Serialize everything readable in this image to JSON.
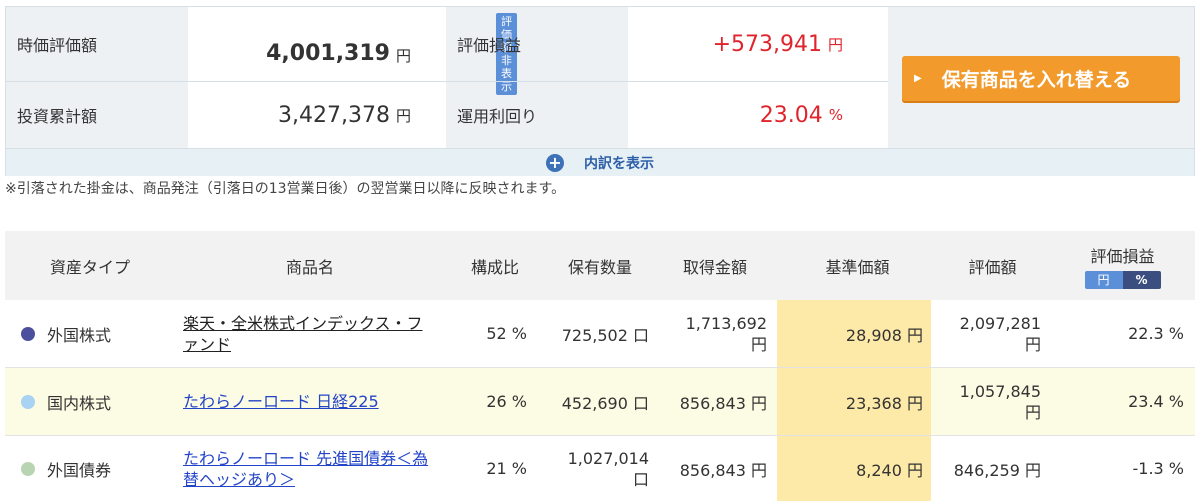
{
  "summary": {
    "market_value_label": "時価評価額",
    "market_value": "4,001,319",
    "hide_badge": "評価額非表示",
    "invested_label": "投資累計額",
    "invested_value": "3,427,378",
    "pl_label": "評価損益",
    "pl_value": "+573,941",
    "yield_label": "運用利回り",
    "yield_value": "23.04",
    "yen_unit": "円",
    "pct_unit": "%",
    "swap_button": "保有商品を入れ替える",
    "detail_toggle": "内訳を表示",
    "plus_icon": "plus-circle-icon",
    "accent_orange": "#f39a2c",
    "positive_color": "#e0242b",
    "negative_color": "#2e9a36"
  },
  "note": "※引落された掛金は、商品発注（引落日の13営業日後）の翌営業日以降に反映されます。",
  "table": {
    "headers": {
      "asset_type": "資産タイプ",
      "product": "商品名",
      "ratio": "構成比",
      "quantity": "保有数量",
      "cost": "取得金額",
      "nav": "基準価額",
      "valuation": "評価額",
      "pl": "評価損益",
      "toggle_yen": "円",
      "toggle_pct": "%"
    },
    "rows": [
      {
        "asset_type": "外国株式",
        "dot_color": "#4b4f9e",
        "product_line1": "楽天・全米株式インデックス・フ",
        "product_line2": "ァンド",
        "ratio": "52 %",
        "quantity": "725,502 口",
        "cost_line1": "1,713,692",
        "cost_line2": "円",
        "nav": "28,908 円",
        "valuation_line1": "2,097,281",
        "valuation_line2": "円",
        "pl": "22.3 %"
      },
      {
        "asset_type": "国内株式",
        "dot_color": "#a9d3f2",
        "product_line1": "たわらノーロード 日経225",
        "ratio": "26 %",
        "quantity": "452,690 口",
        "cost": "856,843 円",
        "nav": "23,368 円",
        "valuation_line1": "1,057,845",
        "valuation_line2": "円",
        "pl": "23.4 %"
      },
      {
        "asset_type": "外国債券",
        "dot_color": "#b9d4b0",
        "product_line1": "たわらノーロード 先進国債券＜為",
        "product_line2": "替ヘッジあり＞",
        "ratio": "21 %",
        "quantity_line1": "1,027,014",
        "quantity_line2": "口",
        "cost": "856,843 円",
        "nav": "8,240 円",
        "valuation": "846,259 円",
        "pl": "-1.3 %"
      }
    ]
  }
}
